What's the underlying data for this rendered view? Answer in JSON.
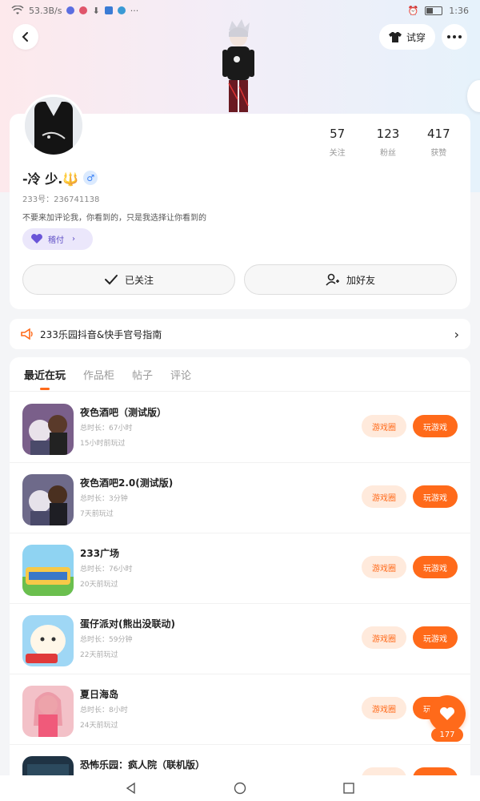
{
  "status_bar": {
    "speed": "53.3B/s",
    "time": "1:36"
  },
  "header": {
    "tryon_label": "试穿"
  },
  "profile": {
    "username": "-冷 少.🔱",
    "gender_symbol": "♂",
    "uid": "233号：236741138",
    "bio": "不要来加评论我，你看到的，只是我选择让你看到的",
    "tag_label": "稽付",
    "stats": [
      {
        "num": "57",
        "label": "关注"
      },
      {
        "num": "123",
        "label": "粉丝"
      },
      {
        "num": "417",
        "label": "获赞"
      }
    ],
    "follow_label": "已关注",
    "add_friend_label": "加好友"
  },
  "notice": {
    "text": "233乐园抖音&快手官号指南"
  },
  "tabs": [
    {
      "label": "最近在玩",
      "active": true
    },
    {
      "label": "作品柜",
      "active": false
    },
    {
      "label": "帖子",
      "active": false
    },
    {
      "label": "评论",
      "active": false
    }
  ],
  "games": [
    {
      "title": "夜色酒吧（测试版）",
      "time": "总时长：67小时",
      "last": "15小时前玩过",
      "circle": "游戏圈",
      "play": "玩游戏"
    },
    {
      "title": "夜色酒吧2.0(测试版)",
      "time": "总时长：3分钟",
      "last": "7天前玩过",
      "circle": "游戏圈",
      "play": "玩游戏"
    },
    {
      "title": "233广场",
      "time": "总时长：76小时",
      "last": "20天前玩过",
      "circle": "游戏圈",
      "play": "玩游戏"
    },
    {
      "title": "蛋仔派对(熊出没联动)",
      "time": "总时长：59分钟",
      "last": "22天前玩过",
      "circle": "游戏圈",
      "play": "玩游戏"
    },
    {
      "title": "夏日海岛",
      "time": "总时长：8小时",
      "last": "24天前玩过",
      "circle": "游戏圈",
      "play": "玩游戏"
    },
    {
      "title": "恐怖乐园：疯人院（联机版）",
      "time": "",
      "last": "",
      "circle": "",
      "play": ""
    }
  ],
  "fab": {
    "count": "177"
  },
  "colors": {
    "accent": "#ff6a1a",
    "accent_light": "#ffeadc",
    "tag_bg": "#ebe7fb",
    "tag_fg": "#5b4bc4"
  }
}
